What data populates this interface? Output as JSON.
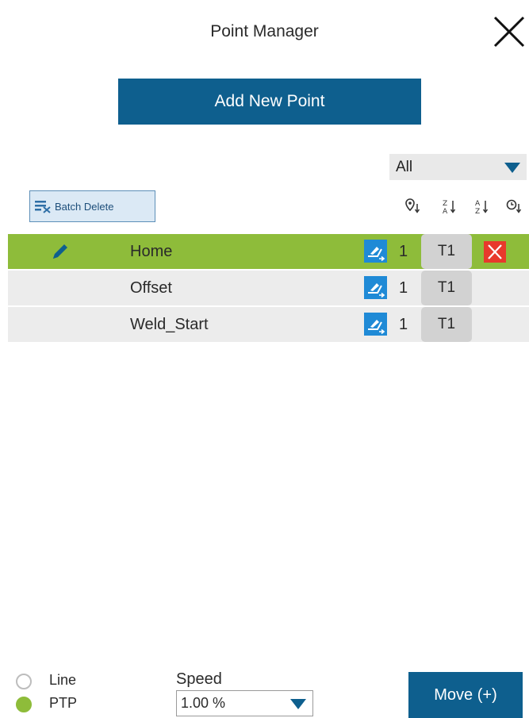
{
  "header": {
    "title": "Point Manager"
  },
  "add_button_label": "Add New Point",
  "filter": {
    "selected": "All"
  },
  "batch_delete_label": "Batch Delete",
  "sort_icons": [
    "sort-by-position-icon",
    "sort-z-a-icon",
    "sort-a-z-icon",
    "sort-by-time-icon"
  ],
  "points": [
    {
      "name": "Home",
      "number": "1",
      "tool": "T1",
      "selected": true
    },
    {
      "name": "Offset",
      "number": "1",
      "tool": "T1",
      "selected": false
    },
    {
      "name": "Weld_Start",
      "number": "1",
      "tool": "T1",
      "selected": false
    }
  ],
  "motion": {
    "line_label": "Line",
    "ptp_label": "PTP",
    "selected": "PTP"
  },
  "speed": {
    "label": "Speed",
    "value": "1.00 %"
  },
  "move_button_label": "Move (+)",
  "colors": {
    "primary": "#0e5f8e",
    "selected_row": "#8ebc3a",
    "delete": "#e8392c",
    "point_type": "#1f8ad6"
  }
}
